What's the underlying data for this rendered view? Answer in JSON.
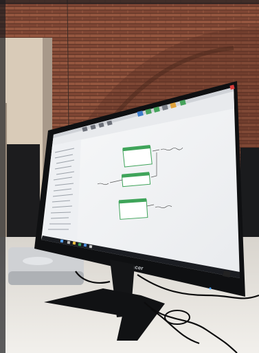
{
  "photo": {
    "subject": "monitor-on-desk",
    "colors": {
      "brick": "#8a4f3a",
      "brick_dark": "#5e3426",
      "wall_left": "#d9cbb8",
      "desk": "#e6e3dd",
      "bezel": "#0f1012",
      "screen_bg": "#f4f5f6",
      "node_header": "#3fa45a",
      "taskbar": "#1b1d22"
    }
  },
  "monitor": {
    "brand": "acer",
    "screen": {
      "app": {
        "nodes": [
          {
            "name": "node-1",
            "label": ""
          },
          {
            "name": "node-2",
            "label": ""
          },
          {
            "name": "node-3",
            "label": ""
          }
        ]
      }
    }
  },
  "icons": {
    "windows": "windows-icon",
    "stand": "monitor-stand",
    "mac_mini": "mini-pc"
  }
}
